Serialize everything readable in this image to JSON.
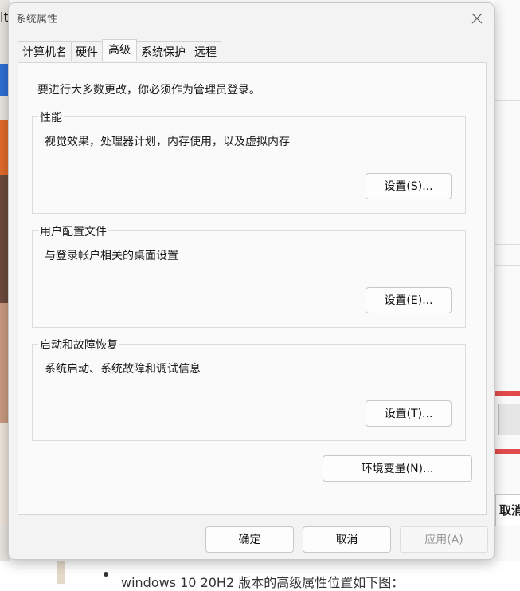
{
  "background": {
    "edge_text": "it",
    "right_cancel_fragment": "取消",
    "bottom_caption": "windows 10 20H2 版本的高级属性位置如下图："
  },
  "dialog": {
    "title": "系统属性",
    "tabs": [
      {
        "label": "计算机名"
      },
      {
        "label": "硬件"
      },
      {
        "label": "高级"
      },
      {
        "label": "系统保护"
      },
      {
        "label": "远程"
      }
    ],
    "active_tab": "高级",
    "admin_note": "要进行大多数更改，你必须作为管理员登录。",
    "groups": {
      "performance": {
        "label": "性能",
        "description": "视觉效果，处理器计划，内存使用，以及虚拟内存",
        "button": "设置(S)..."
      },
      "user_profiles": {
        "label": "用户配置文件",
        "description": "与登录帐户相关的桌面设置",
        "button": "设置(E)..."
      },
      "startup_recovery": {
        "label": "启动和故障恢复",
        "description": "系统启动、系统故障和调试信息",
        "button": "设置(T)..."
      }
    },
    "env_vars_button": "环境变量(N)...",
    "footer": {
      "ok": "确定",
      "cancel": "取消",
      "apply": "应用(A)"
    }
  },
  "icons": {
    "close": "close-icon"
  }
}
